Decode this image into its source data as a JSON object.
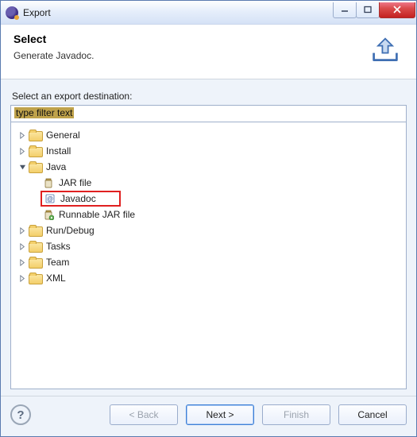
{
  "window": {
    "title": "Export"
  },
  "header": {
    "title": "Select",
    "subtitle": "Generate Javadoc."
  },
  "body": {
    "label": "Select an export destination:",
    "filter_placeholder": "type filter text"
  },
  "tree": {
    "items": [
      {
        "label": "General"
      },
      {
        "label": "Install"
      },
      {
        "label": "Java",
        "children": [
          {
            "label": "JAR file"
          },
          {
            "label": "Javadoc"
          },
          {
            "label": "Runnable JAR file"
          }
        ]
      },
      {
        "label": "Run/Debug"
      },
      {
        "label": "Tasks"
      },
      {
        "label": "Team"
      },
      {
        "label": "XML"
      }
    ],
    "selected": "Javadoc"
  },
  "footer": {
    "back": "< Back",
    "next": "Next >",
    "finish": "Finish",
    "cancel": "Cancel"
  }
}
